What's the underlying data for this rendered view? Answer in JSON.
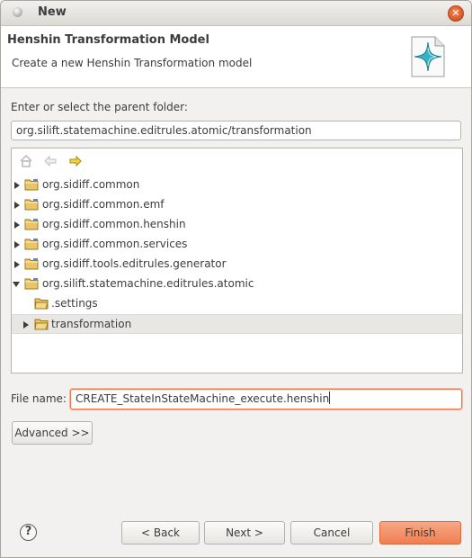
{
  "window": {
    "title": "New"
  },
  "header": {
    "title": "Henshin Transformation Model",
    "description": "Create a new Henshin Transformation model",
    "icon": "henshin-wizard-icon"
  },
  "folder_label": "Enter or select the parent folder:",
  "folder_path": "org.silift.statemachine.editrules.atomic/transformation",
  "tree_toolbar": {
    "home_icon": "home-icon",
    "back_icon": "back-arrow-icon",
    "forward_icon": "forward-arrow-icon"
  },
  "tree": [
    {
      "label": "org.sidiff.common",
      "state": "closed",
      "level": 0
    },
    {
      "label": "org.sidiff.common.emf",
      "state": "closed",
      "level": 0
    },
    {
      "label": "org.sidiff.common.henshin",
      "state": "closed",
      "level": 0
    },
    {
      "label": "org.sidiff.common.services",
      "state": "closed",
      "level": 0
    },
    {
      "label": "org.sidiff.tools.editrules.generator",
      "state": "closed",
      "level": 0
    },
    {
      "label": "org.silift.statemachine.editrules.atomic",
      "state": "open",
      "level": 0
    },
    {
      "label": ".settings",
      "state": "none",
      "level": 1
    },
    {
      "label": "transformation",
      "state": "closed",
      "level": 1,
      "selected": true
    }
  ],
  "file_name_label": "File name:",
  "file_name_value": "CREATE_StateInStateMachine_execute.henshin",
  "advanced_button": "Advanced >>",
  "buttons": {
    "back": "< Back",
    "next": "Next >",
    "cancel": "Cancel",
    "finish": "Finish"
  },
  "help_icon": "help-icon",
  "colors": {
    "accent": "#ef7f52",
    "focus_border": "#f0734a"
  }
}
